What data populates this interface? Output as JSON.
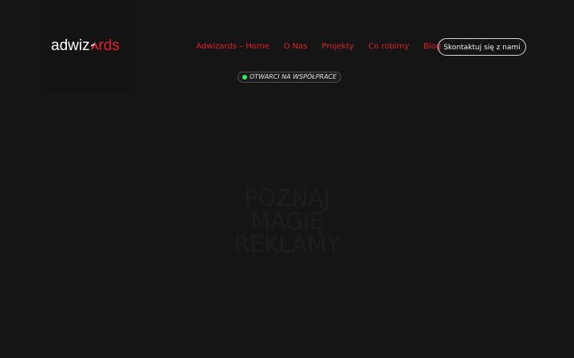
{
  "brand": {
    "logo_part1": "adwiz",
    "logo_part2": "rds"
  },
  "nav": {
    "items": [
      {
        "label": "Adwizards – Home"
      },
      {
        "label": "O Nas"
      },
      {
        "label": "Projekty"
      },
      {
        "label": "Co robimy"
      },
      {
        "label": "Blog"
      }
    ]
  },
  "header": {
    "contact_label": "Skontaktuj się z nami"
  },
  "status": {
    "label": "OTWARCI NA WSPÓŁPRACE",
    "dot_color": "#35ef52"
  },
  "hero": {
    "line1": "POZNAJ",
    "line2": "MAGIĘ",
    "line3": "REKLAMY"
  },
  "colors": {
    "background": "#151515",
    "accent": "#e1212b",
    "text": "#ffffff"
  },
  "icons": {
    "logo_a_mark": "red-chevron-a-icon",
    "status_dot": "green-dot-icon"
  }
}
